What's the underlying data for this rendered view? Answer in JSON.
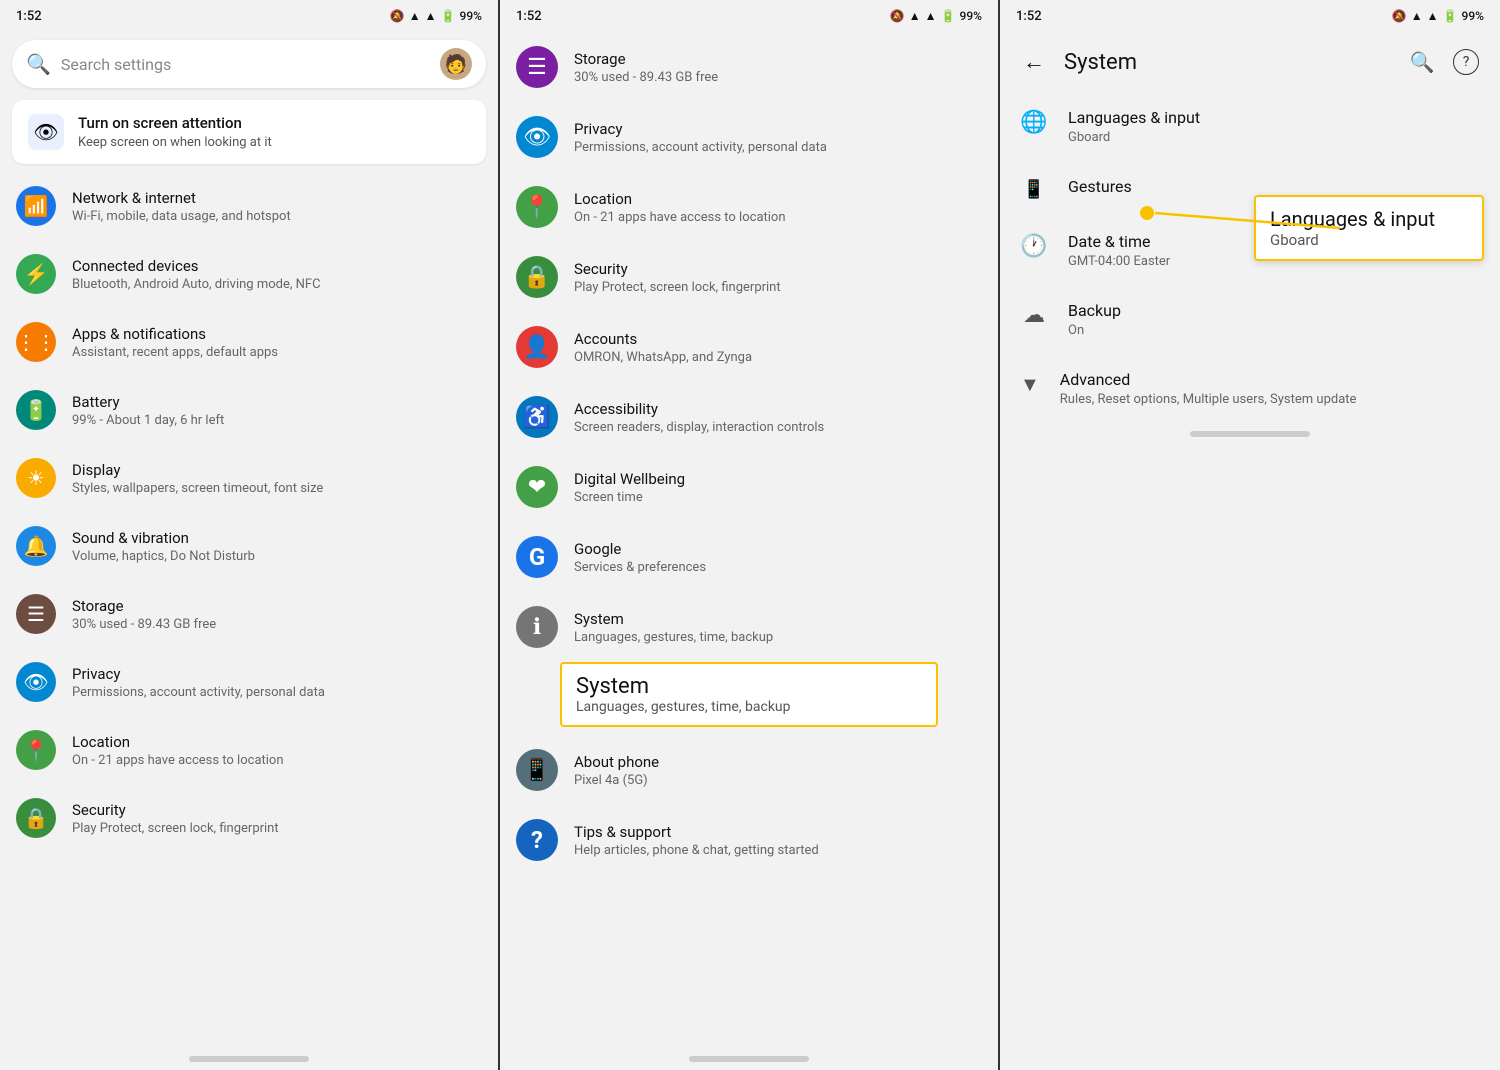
{
  "panel1": {
    "status": {
      "time": "1:52",
      "battery": "99%"
    },
    "search": {
      "placeholder": "Search settings"
    },
    "screen_attention": {
      "title": "Turn on screen attention",
      "subtitle": "Keep screen on when looking at it"
    },
    "items": [
      {
        "id": "network",
        "title": "Network & internet",
        "sub": "Wi-Fi, mobile, data usage, and hotspot",
        "icon_color": "#1a73e8",
        "icon": "📶"
      },
      {
        "id": "connected",
        "title": "Connected devices",
        "sub": "Bluetooth, Android Auto, driving mode, NFC",
        "icon_color": "#34a853",
        "icon": "📱"
      },
      {
        "id": "apps",
        "title": "Apps & notifications",
        "sub": "Assistant, recent apps, default apps",
        "icon_color": "#f57c00",
        "icon": "⋮⋮⋮"
      },
      {
        "id": "battery",
        "title": "Battery",
        "sub": "99% - About 1 day, 6 hr left",
        "icon_color": "#00897b",
        "icon": "🔋"
      },
      {
        "id": "display",
        "title": "Display",
        "sub": "Styles, wallpapers, screen timeout, font size",
        "icon_color": "#f9ab00",
        "icon": "☀"
      },
      {
        "id": "sound",
        "title": "Sound & vibration",
        "sub": "Volume, haptics, Do Not Disturb",
        "icon_color": "#1e88e5",
        "icon": "🔔"
      },
      {
        "id": "storage",
        "title": "Storage",
        "sub": "30% used - 89.43 GB free",
        "icon_color": "#6d4c41",
        "icon": "☰"
      },
      {
        "id": "privacy",
        "title": "Privacy",
        "sub": "Permissions, account activity, personal data",
        "icon_color": "#0288d1",
        "icon": "👁"
      },
      {
        "id": "location",
        "title": "Location",
        "sub": "On - 21 apps have access to location",
        "icon_color": "#43a047",
        "icon": "📍"
      },
      {
        "id": "security",
        "title": "Security",
        "sub": "Play Protect, screen lock, fingerprint",
        "icon_color": "#388e3c",
        "icon": "🔒"
      }
    ]
  },
  "panel2": {
    "status": {
      "time": "1:52",
      "battery": "99%"
    },
    "items": [
      {
        "id": "storage",
        "title": "Storage",
        "sub": "30% used - 89.43 GB free",
        "icon_color": "#7b1fa2",
        "icon": "☰"
      },
      {
        "id": "privacy",
        "title": "Privacy",
        "sub": "Permissions, account activity, personal data",
        "icon_color": "#0288d1",
        "icon": "👁"
      },
      {
        "id": "location",
        "title": "Location",
        "sub": "On - 21 apps have access to location",
        "icon_color": "#43a047",
        "icon": "📍"
      },
      {
        "id": "security",
        "title": "Security",
        "sub": "Play Protect, screen lock, fingerprint",
        "icon_color": "#388e3c",
        "icon": "🔒"
      },
      {
        "id": "accounts",
        "title": "Accounts",
        "sub": "OMRON, WhatsApp, and Zynga",
        "icon_color": "#e53935",
        "icon": "👤"
      },
      {
        "id": "accessibility",
        "title": "Accessibility",
        "sub": "Screen readers, display, interaction controls",
        "icon_color": "#0277bd",
        "icon": "♿"
      },
      {
        "id": "digitalwellbeing",
        "title": "Digital Wellbeing",
        "sub": "Screen time",
        "icon_color": "#43a047",
        "icon": "❤"
      },
      {
        "id": "google",
        "title": "Google",
        "sub": "Services & preferences",
        "icon_color": "#1a73e8",
        "icon": "G"
      },
      {
        "id": "system",
        "title": "System",
        "sub": "Languages, gestures, time, backup",
        "icon_color": "#757575",
        "icon": "ℹ"
      },
      {
        "id": "aboutphone",
        "title": "About phone",
        "sub": "Pixel 4a (5G)",
        "icon_color": "#546e7a",
        "icon": "📱"
      },
      {
        "id": "tipssupport",
        "title": "Tips & support",
        "sub": "Help articles, phone & chat, getting started",
        "icon_color": "#1565c0",
        "icon": "?"
      }
    ],
    "system_callout": {
      "title": "System",
      "sub": "Languages, gestures, time, backup"
    }
  },
  "panel3": {
    "status": {
      "time": "1:52",
      "battery": "99%"
    },
    "header": {
      "title": "System",
      "back_label": "←",
      "search_label": "🔍",
      "help_label": "?"
    },
    "items": [
      {
        "id": "languages",
        "title": "Languages & input",
        "sub": "Gboard",
        "icon": "🌐"
      },
      {
        "id": "gestures",
        "title": "Gestures",
        "sub": "",
        "icon": "📱"
      },
      {
        "id": "datetime",
        "title": "Date & time",
        "sub": "GMT-04:00 Easter",
        "icon": "🕐"
      },
      {
        "id": "backup",
        "title": "Backup",
        "sub": "On",
        "icon": "☁"
      }
    ],
    "advanced": {
      "title": "Advanced",
      "sub": "Rules, Reset options, Multiple users, System update",
      "icon": "▼"
    },
    "lang_callout": {
      "title": "Languages & input",
      "sub": "Gboard"
    }
  }
}
